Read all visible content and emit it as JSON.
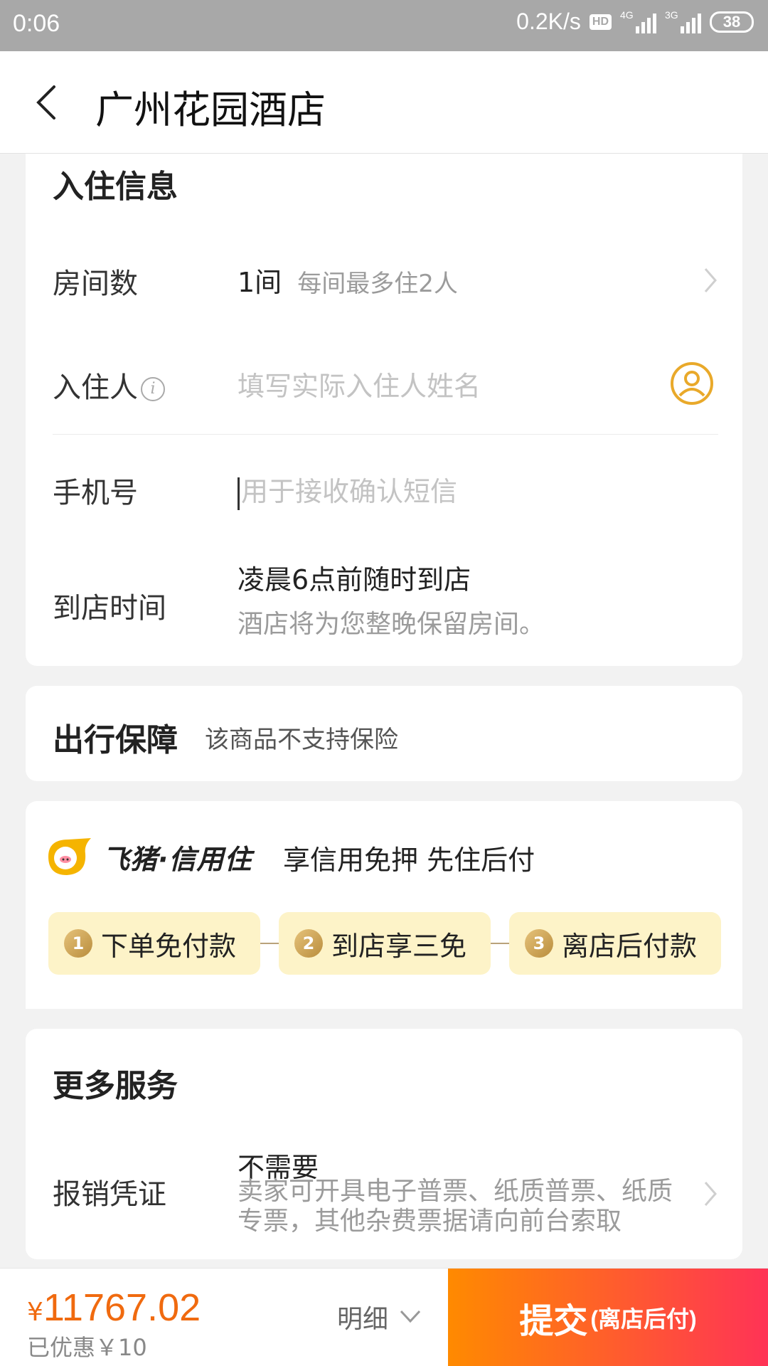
{
  "status_bar": {
    "time": "0:06",
    "net_speed": "0.2K/s",
    "hd": "HD",
    "signal1": "4G",
    "signal2": "3G",
    "battery": "38"
  },
  "header": {
    "title": "广州花园酒店"
  },
  "checkin": {
    "title": "入住信息",
    "rooms_label": "房间数",
    "rooms_value": "1间",
    "rooms_note": "每间最多住2人",
    "guest_label": "入住人",
    "guest_placeholder": "填写实际入住人姓名",
    "phone_label": "手机号",
    "phone_placeholder": "用于接收确认短信",
    "arrival_label": "到店时间",
    "arrival_value": "凌晨6点前随时到店",
    "arrival_note": "酒店将为您整晚保留房间。"
  },
  "travel": {
    "title": "出行保障",
    "note": "该商品不支持保险"
  },
  "credit": {
    "brand": "飞猪·信用住",
    "slogan": "享信用免押 先住后付",
    "steps": [
      {
        "num": "1",
        "label": "下单免付款"
      },
      {
        "num": "2",
        "label": "到店享三免"
      },
      {
        "num": "3",
        "label": "离店后付款"
      }
    ]
  },
  "services": {
    "title": "更多服务",
    "invoice_label": "报销凭证",
    "invoice_value": "不需要",
    "invoice_note": "卖家可开具电子普票、纸质普票、纸质专票，其他杂费票据请向前台索取"
  },
  "bottom": {
    "currency": "¥",
    "price": "11767.02",
    "saved": "已优惠￥10",
    "detail": "明细",
    "submit": "提交",
    "submit_sub": "(离店后付)"
  },
  "colors": {
    "accent": "#f06a0f",
    "icon_gold": "#e9a92a",
    "submit_start": "#ff8a00",
    "submit_end": "#ff3356"
  }
}
